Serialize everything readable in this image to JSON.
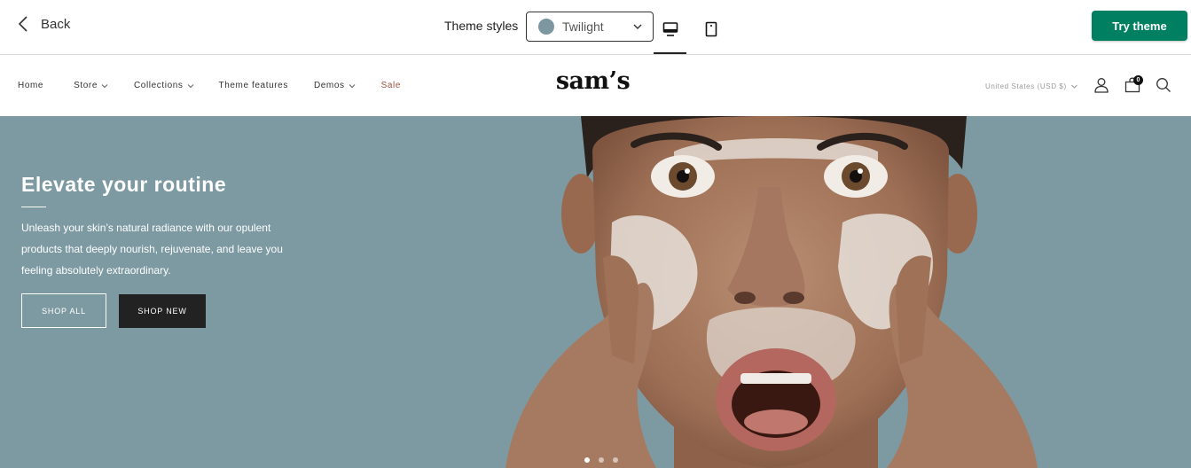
{
  "topbar": {
    "back_label": "Back",
    "theme_styles_label": "Theme styles",
    "theme_style_value": "Twilight",
    "theme_swatch_color": "#7d97a0",
    "device_options": [
      "desktop-icon",
      "mobile-icon"
    ],
    "active_device": "desktop",
    "try_theme_label": "Try theme",
    "try_theme_color": "#008060"
  },
  "store": {
    "logo": "sam’s",
    "nav": {
      "home": "Home",
      "store": "Store",
      "collections": "Collections",
      "theme_features": "Theme features",
      "demos": "Demos",
      "sale": "Sale"
    },
    "currency": "United States (USD $)",
    "cart_count": "0",
    "sale_color": "#a0503f"
  },
  "hero": {
    "title": "Elevate your routine",
    "body": "Unleash your skin’s natural radiance with our opulent products that deeply nourish, rejuvenate, and leave you feeling absolutely extraordinary.",
    "shop_all_label": "SHOP ALL",
    "shop_new_label": "SHOP NEW",
    "background_color": "#7d9aa2",
    "slides_total": 3,
    "active_slide": 1
  }
}
